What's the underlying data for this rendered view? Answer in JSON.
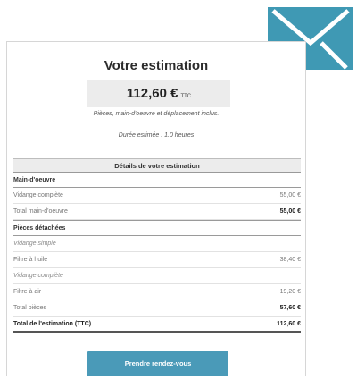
{
  "estimate": {
    "title": "Votre estimation",
    "price": "112,60 €",
    "price_suffix": "TTC",
    "includes_note": "Pièces, main-d'oeuvre et déplacement inclus.",
    "duration_note": "Durée estimée : 1.0 heures"
  },
  "details": {
    "heading": "Détails de votre estimation",
    "rows": [
      {
        "label": "Main-d'oeuvre",
        "value": ""
      },
      {
        "label": "Vidange complète",
        "value": "55,00 €"
      },
      {
        "label": "Total main-d'oeuvre",
        "value": "55,00 €"
      },
      {
        "label": "Pièces détachées",
        "value": ""
      },
      {
        "label": "Vidange simple",
        "value": ""
      },
      {
        "label": "Filtre à huile",
        "value": "38,40 €"
      },
      {
        "label": "Vidange complète",
        "value": ""
      },
      {
        "label": "Filtre à air",
        "value": "19,20 €"
      },
      {
        "label": "Total pièces",
        "value": "57,60 €"
      },
      {
        "label": "Total de l'estimation (TTC)",
        "value": "112,60 €"
      }
    ]
  },
  "cta": {
    "label": "Prendre rendez-vous"
  },
  "icons": {
    "mail": "envelope-icon"
  },
  "colors": {
    "accent": "#4a9ab8",
    "mail_bg": "#3f99b4"
  }
}
